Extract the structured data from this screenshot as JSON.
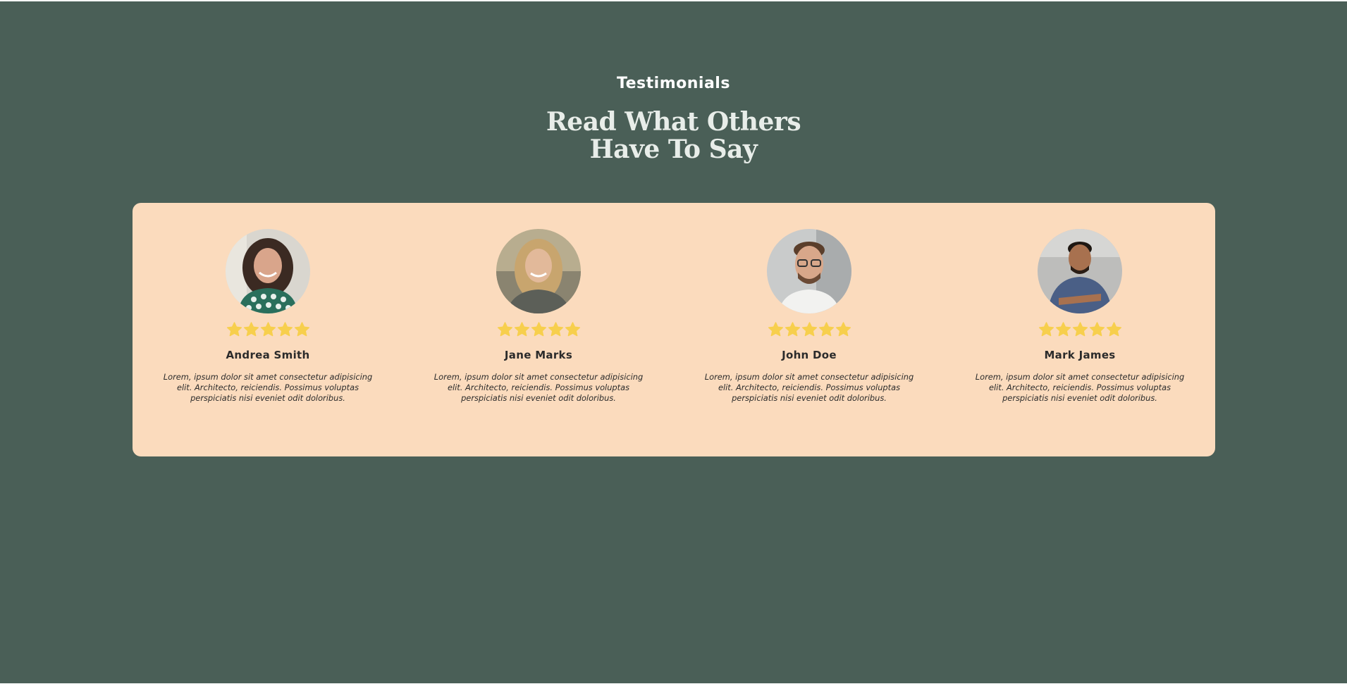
{
  "section": {
    "label": "Testimonials",
    "headline_line1": "Read What Others",
    "headline_line2": "Have To Say"
  },
  "colors": {
    "background": "#4a5f57",
    "card": "#fbdbbd",
    "star": "#f7cf4d",
    "text": "#2b2b2b"
  },
  "testimonials": [
    {
      "name": "Andrea Smith",
      "rating": 5,
      "avatar": "woman-curly-hair-photo",
      "quote": "Lorem, ipsum dolor sit amet consectetur adipisicing elit. Architecto, reiciendis. Possimus voluptas perspiciatis nisi eveniet odit doloribus."
    },
    {
      "name": "Jane Marks",
      "rating": 5,
      "avatar": "woman-blonde-hair-photo",
      "quote": "Lorem, ipsum dolor sit amet consectetur adipisicing elit. Architecto, reiciendis. Possimus voluptas perspiciatis nisi eveniet odit doloribus."
    },
    {
      "name": "John Doe",
      "rating": 5,
      "avatar": "man-glasses-photo",
      "quote": "Lorem, ipsum dolor sit amet consectetur adipisicing elit. Architecto, reiciendis. Possimus voluptas perspiciatis nisi eveniet odit doloribus."
    },
    {
      "name": "Mark James",
      "rating": 5,
      "avatar": "man-blue-tshirt-photo",
      "quote": "Lorem, ipsum dolor sit amet consectetur adipisicing elit. Architecto, reiciendis. Possimus voluptas perspiciatis nisi eveniet odit doloribus."
    }
  ]
}
